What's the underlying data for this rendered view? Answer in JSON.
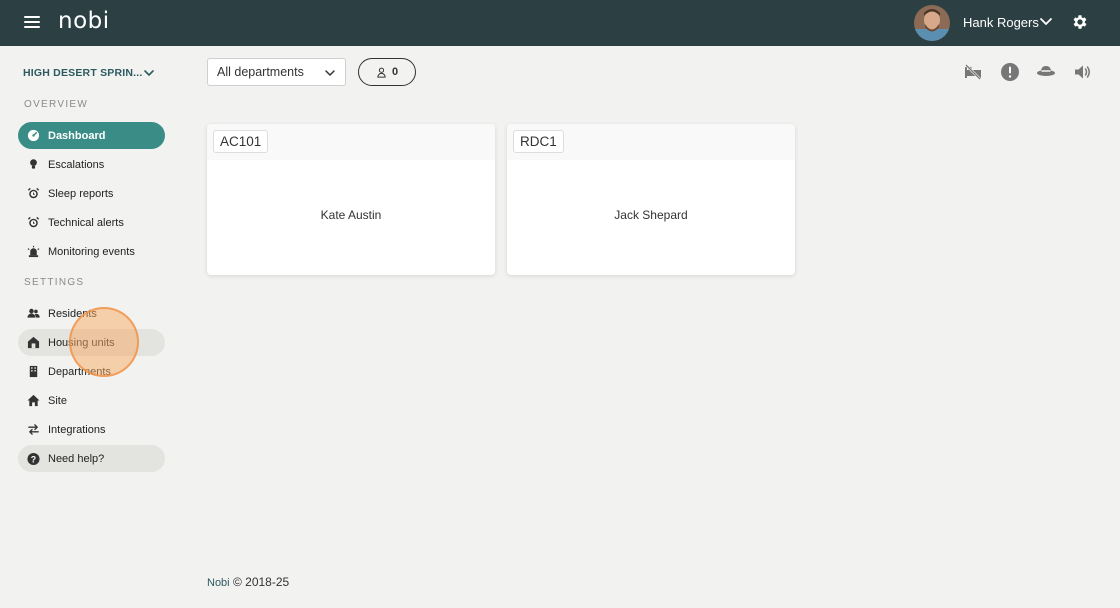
{
  "header": {
    "logo": "nobi",
    "user_name": "Hank Rogers"
  },
  "sidebar": {
    "site_name": "HIGH DESERT SPRIN...",
    "overview_label": "OVERVIEW",
    "settings_label": "SETTINGS",
    "overview_items": [
      {
        "label": "Dashboard",
        "icon": "dashboard-icon"
      },
      {
        "label": "Escalations",
        "icon": "lightbulb-icon"
      },
      {
        "label": "Sleep reports",
        "icon": "alarm-clock-icon"
      },
      {
        "label": "Technical alerts",
        "icon": "alarm-clock-icon"
      },
      {
        "label": "Monitoring events",
        "icon": "siren-icon"
      }
    ],
    "settings_items": [
      {
        "label": "Residents",
        "icon": "users-icon"
      },
      {
        "label": "Housing units",
        "icon": "house-icon"
      },
      {
        "label": "Departments",
        "icon": "building-icon"
      },
      {
        "label": "Site",
        "icon": "home-icon"
      },
      {
        "label": "Integrations",
        "icon": "arrows-exchange-icon"
      }
    ],
    "help_label": "Need help?"
  },
  "toolbar": {
    "department_filter": "All departments",
    "resident_count": "0"
  },
  "units": [
    {
      "code": "AC101",
      "resident": "Kate Austin"
    },
    {
      "code": "RDC1",
      "resident": "Jack Shepard"
    }
  ],
  "footer": {
    "brand": "Nobi",
    "copyright": "© 2018-25"
  },
  "colors": {
    "topbar": "#2c3f43",
    "accent": "#3a8d86",
    "background": "#f2f2f1"
  }
}
